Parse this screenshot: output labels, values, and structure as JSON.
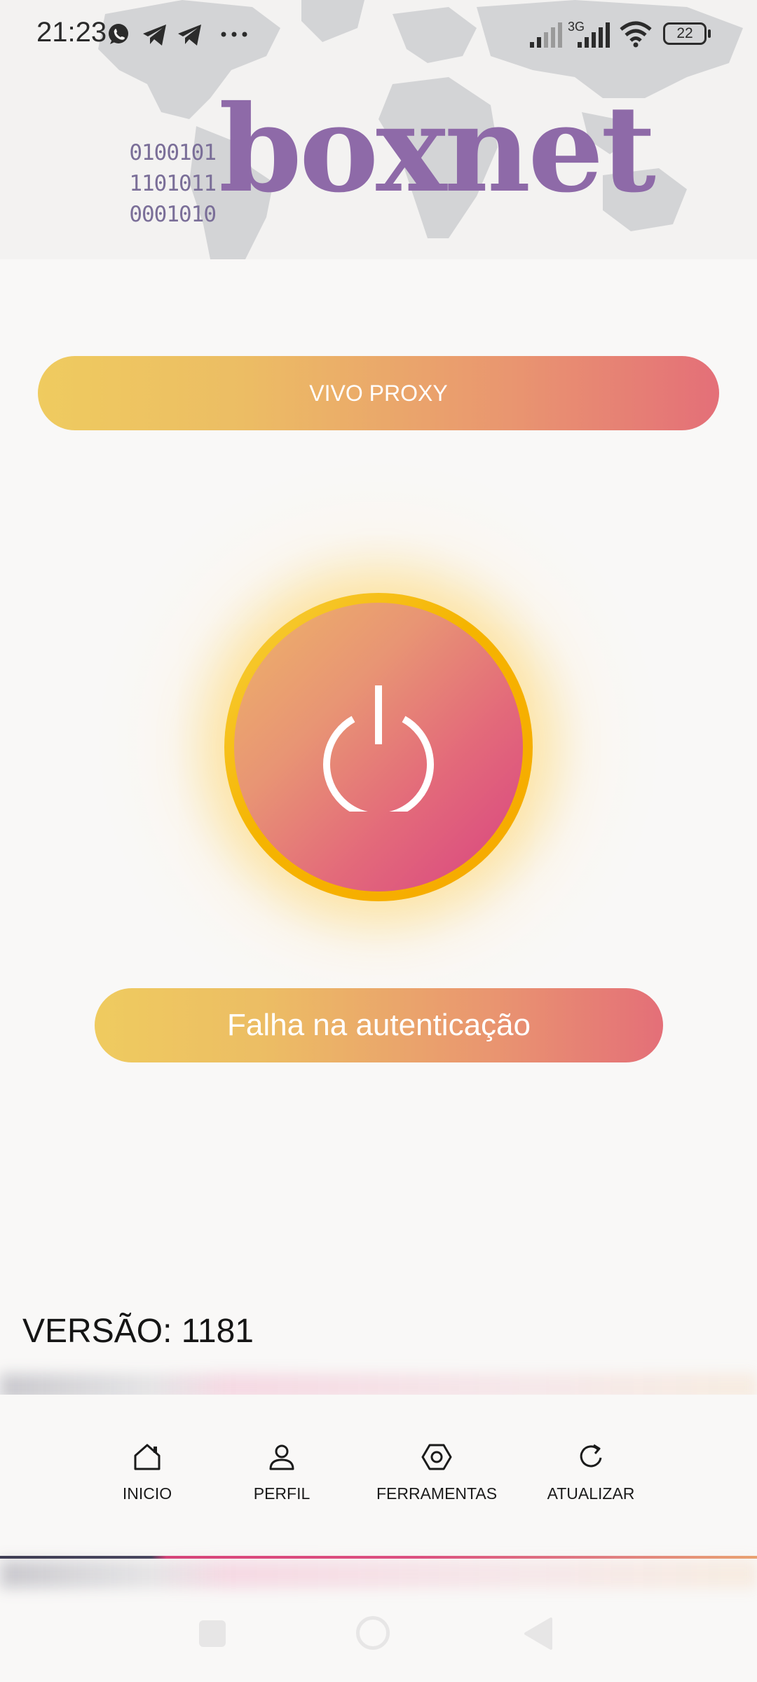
{
  "status_bar": {
    "time": "21:23",
    "network_label": "3G",
    "battery": "22",
    "notification_icons": [
      "whatsapp-icon",
      "telegram-icon",
      "telegram-icon",
      "more-dots-icon"
    ]
  },
  "header": {
    "logo_binary": [
      "0100101",
      "1101011",
      "0001010"
    ],
    "logo_text": "boxnet"
  },
  "profile": {
    "label": "VIVO PROXY"
  },
  "connection": {
    "status": "Falha na autenticação",
    "button_icon": "power-icon"
  },
  "version": {
    "text": "VERSÃO: 1181"
  },
  "bottom_nav": {
    "items": [
      {
        "label": "INICIO",
        "icon": "home-icon"
      },
      {
        "label": "PERFIL",
        "icon": "person-icon"
      },
      {
        "label": "FERRAMENTAS",
        "icon": "hexagon-settings-icon"
      },
      {
        "label": "ATUALIZAR",
        "icon": "refresh-icon"
      }
    ]
  },
  "colors": {
    "gradient_start": "#efcb5f",
    "gradient_end": "#e46f78",
    "logo": "#8e6aa8",
    "ring": "#f5b400"
  }
}
